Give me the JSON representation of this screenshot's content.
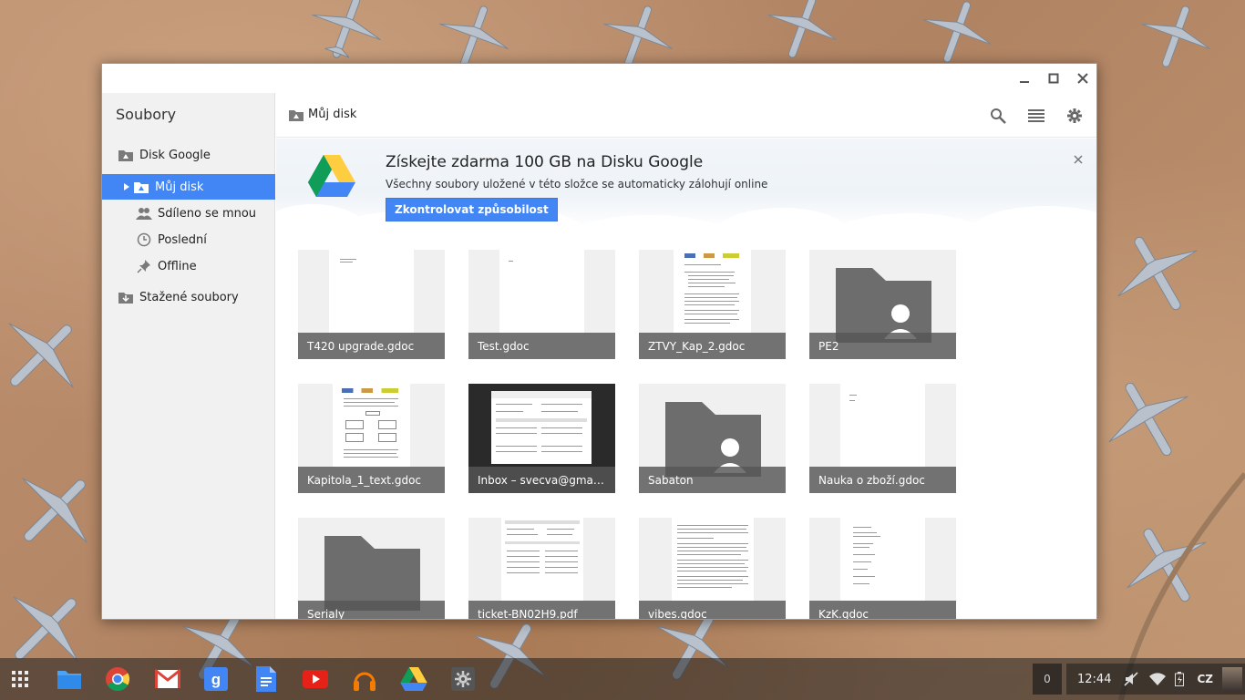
{
  "sidebar": {
    "title": "Soubory",
    "items": [
      {
        "label": "Disk Google"
      },
      {
        "label": "Můj disk"
      },
      {
        "label": "Sdíleno se mnou"
      },
      {
        "label": "Poslední"
      },
      {
        "label": "Offline"
      },
      {
        "label": "Stažené soubory"
      }
    ]
  },
  "toolbar": {
    "breadcrumb": "Můj disk"
  },
  "banner": {
    "title": "Získejte zdarma 100 GB na Disku Google",
    "subtitle": "Všechny soubory uložené v této složce se automaticky zálohují online",
    "button": "Zkontrolovat způsobilost"
  },
  "files": [
    {
      "name": "T420 upgrade.gdoc",
      "kind": "doc"
    },
    {
      "name": "Test.gdoc",
      "kind": "doc"
    },
    {
      "name": "ZTVY_Kap_2.gdoc",
      "kind": "doc"
    },
    {
      "name": "PE2",
      "kind": "shared-folder"
    },
    {
      "name": "Kapitola_1_text.gdoc",
      "kind": "doc"
    },
    {
      "name": "Inbox – svecva@gmail....",
      "kind": "screenshot"
    },
    {
      "name": "Sabaton",
      "kind": "shared-folder"
    },
    {
      "name": "Nauka o zboží.gdoc",
      "kind": "doc"
    },
    {
      "name": "Serialy",
      "kind": "folder"
    },
    {
      "name": "ticket-BN02H9.pdf",
      "kind": "pdf"
    },
    {
      "name": "vibes.gdoc",
      "kind": "doc"
    },
    {
      "name": "KzK.gdoc",
      "kind": "doc"
    }
  ],
  "shelf": {
    "apps": [
      "launcher-icon",
      "files-app-icon",
      "chrome-icon",
      "gmail-icon",
      "google-search-icon",
      "docs-icon",
      "youtube-icon",
      "music-icon",
      "drive-icon",
      "settings-icon"
    ],
    "notification_count": "0",
    "time": "12:44",
    "input_method": "CZ"
  },
  "colors": {
    "accent": "#4285f4",
    "caption_bg": "#555555",
    "folder": "#6d6d6d"
  }
}
